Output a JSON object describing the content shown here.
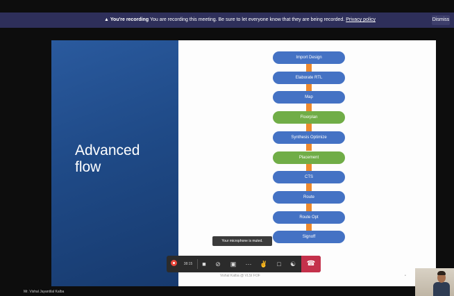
{
  "banner": {
    "bold": "You're recording",
    "text": "You are recording this meeting. Be sure to let everyone know that they are being recorded.",
    "policy": "Privacy policy",
    "dismiss": "Dismiss"
  },
  "slide": {
    "title_line1": "Advanced",
    "title_line2": "flow",
    "footer": "Vishal Kalba @ VLSI FOF",
    "flow_nodes": [
      {
        "label": "Import Design",
        "color": "#4472c4"
      },
      {
        "label": "Elaborate RTL",
        "color": "#4472c4"
      },
      {
        "label": "Map",
        "color": "#4472c4"
      },
      {
        "label": "Floorplan",
        "color": "#70ad47"
      },
      {
        "label": "Synthesis Optimize",
        "color": "#4472c4"
      },
      {
        "label": "Placement",
        "color": "#70ad47"
      },
      {
        "label": "CTS",
        "color": "#4472c4"
      },
      {
        "label": "Route",
        "color": "#4472c4"
      },
      {
        "label": "Route Opt",
        "color": "#4472c4"
      },
      {
        "label": "Signoff",
        "color": "#4472c4"
      }
    ]
  },
  "tooltip": "Your microphone is muted.",
  "toolbar": {
    "timer": "38:15",
    "camera_icon": "camera-icon",
    "mic_icon": "mic-muted-icon",
    "share_icon": "share-screen-icon",
    "more_icon": "more-icon",
    "hand_icon": "raise-hand-icon",
    "chat_icon": "chat-icon",
    "people_icon": "participants-icon",
    "leave_icon": "leave-call-icon"
  },
  "participant_name": "Mr. Vishal Jayantilal Kalba"
}
